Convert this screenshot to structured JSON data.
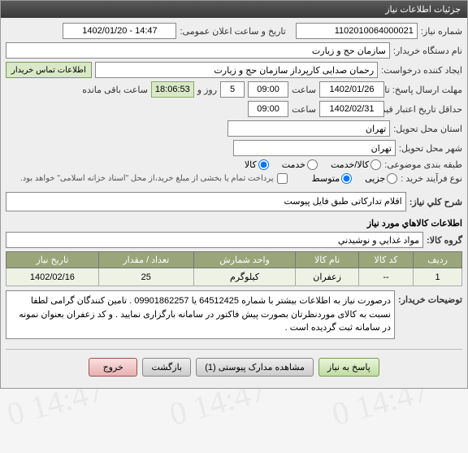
{
  "titlebar": "جزئیات اطلاعات نیاز",
  "fields": {
    "need_no_lbl": "شماره نیاز:",
    "need_no": "1102010064000021",
    "public_date_lbl": "تاریخ و ساعت اعلان عمومی:",
    "public_date": "1402/01/20 - 14:47",
    "buyer_lbl": "نام دستگاه خریدار:",
    "buyer": "سازمان حج و زیارت",
    "requester_lbl": "ایجاد کننده درخواست:",
    "requester": "رحمان صدایی کارپرداز سازمان حج و زیارت",
    "contact_btn": "اطلاعات تماس خریدار",
    "deadline_lbl": "مهلت ارسال پاسخ: تا تاریخ:",
    "deadline_date": "1402/01/26",
    "time_lbl": "ساعت",
    "deadline_time": "09:00",
    "day_lbl": "روز و",
    "day_count": "5",
    "remain_time": "18:06:53",
    "remain_lbl": "ساعت باقی مانده",
    "valid_lbl": "حداقل تاریخ اعتبار قیمت: تا تاریخ:",
    "valid_date": "1402/02/31",
    "valid_time": "09:00",
    "deliver_city_lbl": "استان محل تحویل:",
    "deliver_city": "تهران",
    "deliver_town_lbl": "شهر محل تحویل:",
    "deliver_town": "تهران",
    "category_lbl": "طبقه بندی موضوعی:",
    "cat1": "کالا/خدمت",
    "cat2": "خدمت",
    "cat3": "کالا",
    "process_lbl": "نوع فرآیند خرید :",
    "p1": "جزیی",
    "p2": "متوسط",
    "payment_note": "پرداخت تمام یا بخشی از مبلغ خرید،از محل \"اسناد خزانه اسلامی\" خواهد بود.",
    "summary_lbl": "شرح کلي نياز:",
    "summary": "اقلام تدارکاتی طبق فایل پیوست",
    "section_goods": "اطلاعات کالاهاي مورد نياز",
    "group_lbl": "گروه کالا:",
    "group": "مواد غذايي و نوشيدني",
    "buyer_desc_lbl": "توضيحات خریدار:",
    "buyer_desc": "درصورت نیاز به اطلاعات بیشتر با شماره 64512425 یا 09901862257 . تامین کنندگان گرامی لطفا نسبت به کالای موردنظرتان بصورت پیش فاکتور در سامانه بارگزاری نمایید . و کد زعفران بعنوان نمونه در سامانه ثبت گردیده است .",
    "btn_reply": "پاسخ به نیاز",
    "btn_attach": "مشاهده مدارک پیوستی (1)",
    "btn_back": "بازگشت",
    "btn_exit": "خروج"
  },
  "table": {
    "headers": [
      "ردیف",
      "کد کالا",
      "نام کالا",
      "واحد شمارش",
      "تعداد / مقدار",
      "تاریخ نیاز"
    ],
    "rows": [
      {
        "idx": "1",
        "code": "--",
        "name": "زعفران",
        "unit": "کیلوگرم",
        "qty": "25",
        "date": "1402/02/16"
      }
    ]
  }
}
